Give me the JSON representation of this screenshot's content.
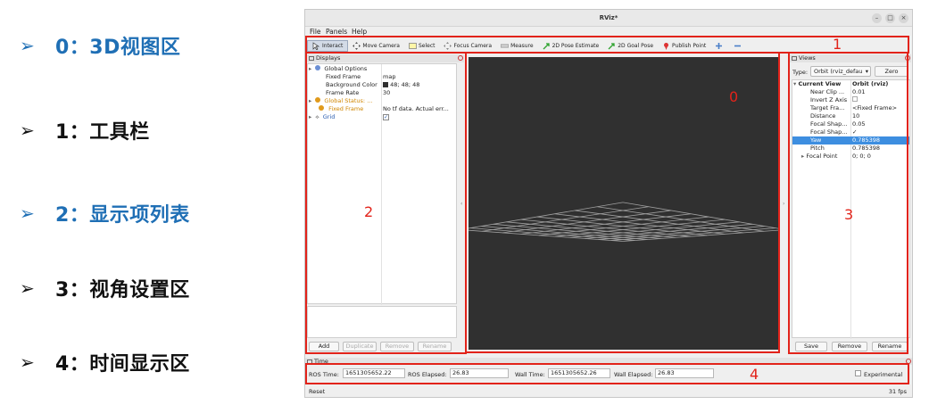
{
  "legend": [
    {
      "num": "0",
      "text": "0：3D视图区",
      "blue": true
    },
    {
      "num": "1",
      "text": "1：工具栏",
      "blue": false
    },
    {
      "num": "2",
      "text": "2：显示项列表",
      "blue": true
    },
    {
      "num": "3",
      "text": "3：视角设置区",
      "blue": false
    },
    {
      "num": "4",
      "text": "4：时间显示区",
      "blue": false
    }
  ],
  "legend_arrow": "➢",
  "window": {
    "title": "RViz*"
  },
  "menu": [
    "File",
    "Panels",
    "Help"
  ],
  "toolbar": [
    "Interact",
    "Move Camera",
    "Select",
    "Focus Camera",
    "Measure",
    "2D Pose Estimate",
    "2D Goal Pose",
    "Publish Point"
  ],
  "displays": {
    "header": "Displays",
    "rows": [
      {
        "name": "Global Options",
        "value": ""
      },
      {
        "name": "Fixed Frame",
        "value": "map"
      },
      {
        "name": "Background Color",
        "value": "48; 48; 48"
      },
      {
        "name": "Frame Rate",
        "value": "30"
      },
      {
        "name": "Global Status: ...",
        "value": ""
      },
      {
        "name": "Fixed Frame",
        "value": "No tf data.  Actual err..."
      },
      {
        "name": "Grid",
        "value": "✓"
      }
    ],
    "buttons": [
      "Add",
      "Duplicate",
      "Remove",
      "Rename"
    ]
  },
  "views": {
    "header": "Views",
    "type_label": "Type:",
    "type_value": "Orbit (rviz_defau",
    "zero": "Zero",
    "rows": [
      {
        "name": "Current View",
        "value": "Orbit (rviz)"
      },
      {
        "name": "Near Clip ...",
        "value": "0.01"
      },
      {
        "name": "Invert Z Axis",
        "value": ""
      },
      {
        "name": "Target Fra...",
        "value": "<Fixed Frame>"
      },
      {
        "name": "Distance",
        "value": "10"
      },
      {
        "name": "Focal Shap...",
        "value": "0.05"
      },
      {
        "name": "Focal Shap...",
        "value": "✓"
      },
      {
        "name": "Yaw",
        "value": "0.785398"
      },
      {
        "name": "Pitch",
        "value": "0.785398"
      },
      {
        "name": "Focal Point",
        "value": "0; 0; 0"
      }
    ],
    "buttons": [
      "Save",
      "Remove",
      "Rename"
    ]
  },
  "time": {
    "header": "Time",
    "ros_time_label": "ROS Time:",
    "ros_time": "1651305652.22",
    "ros_elapsed_label": "ROS Elapsed:",
    "ros_elapsed": "26.83",
    "wall_time_label": "Wall Time:",
    "wall_time": "1651305652.26",
    "wall_elapsed_label": "Wall Elapsed:",
    "wall_elapsed": "26.83",
    "experimental": "Experimental"
  },
  "status": {
    "reset": "Reset",
    "fps": "31 fps"
  },
  "colors": {
    "annotation": "#e2231a",
    "legend_blue": "#1f6fb5",
    "viewport_bg": "#303030",
    "grid": "#a0a0a0",
    "selection": "#3d8ee0"
  }
}
